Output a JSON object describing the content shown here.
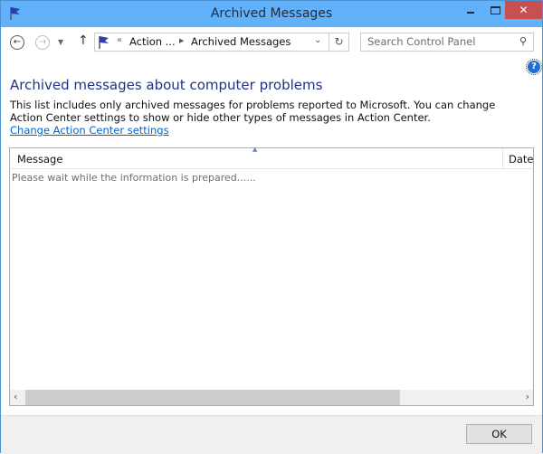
{
  "window": {
    "title": "Archived Messages",
    "controls": {
      "minimize": "minimize",
      "maximize": "maximize",
      "close": "✕"
    }
  },
  "navbar": {
    "back_icon": "←",
    "forward_icon": "→",
    "recent_icon": "▼",
    "up_icon": "↑",
    "address": {
      "overflow": "«",
      "crumbs": [
        "Action ...",
        "Archived Messages"
      ],
      "separator": "▶",
      "dropdown_icon": "⌄"
    },
    "refresh_icon": "↻",
    "search": {
      "placeholder": "Search Control Panel",
      "icon": "⚲"
    }
  },
  "help_icon": "?",
  "content": {
    "heading": "Archived messages about computer problems",
    "description": "This list includes only archived messages for problems reported to Microsoft. You can change Action Center settings to show or hide other types of messages in Action Center.",
    "link": "Change Action Center settings"
  },
  "list": {
    "columns": [
      "Message",
      "Date"
    ],
    "sort_indicator": "▲",
    "status_text": "Please wait while the information is prepared......",
    "scroll_left": "‹",
    "scroll_right": "›"
  },
  "footer": {
    "ok_label": "OK"
  },
  "colors": {
    "titlebar": "#62b1fb",
    "close": "#c75050",
    "heading": "#1e3287",
    "link": "#0066cc"
  }
}
